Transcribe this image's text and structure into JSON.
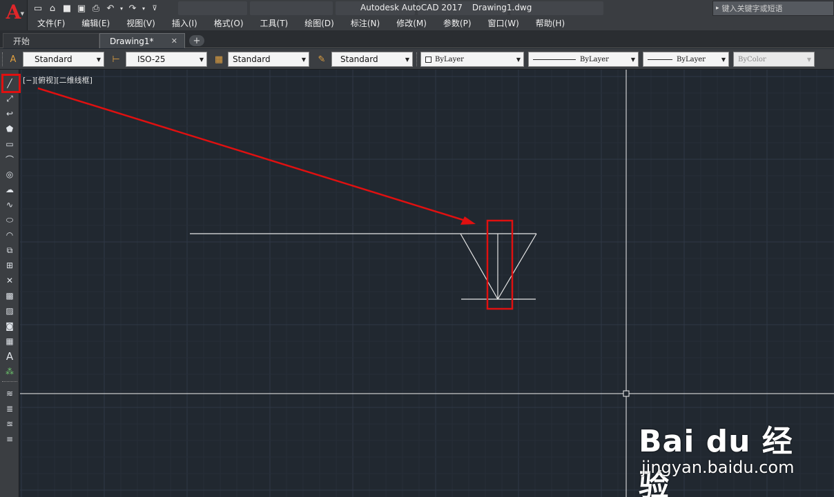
{
  "app": {
    "title": "Autodesk AutoCAD 2017",
    "document": "Drawing1.dwg",
    "logo_letter": "A",
    "accent": "#e0262a"
  },
  "search": {
    "placeholder": "键入关键字或短语"
  },
  "menu": {
    "items": [
      "文件(F)",
      "编辑(E)",
      "视图(V)",
      "插入(I)",
      "格式(O)",
      "工具(T)",
      "绘图(D)",
      "标注(N)",
      "修改(M)",
      "参数(P)",
      "窗口(W)",
      "帮助(H)"
    ]
  },
  "tabs": {
    "start": "开始",
    "drawing": "Drawing1*",
    "close": "✕",
    "add": "+"
  },
  "styles": {
    "text_style": "Standard",
    "dim_style": "ISO-25",
    "table_style": "Standard",
    "mleader_style": "Standard",
    "color": "ByLayer",
    "linetype": "ByLayer",
    "lineweight": "ByLayer",
    "plotstyle": "ByColor"
  },
  "viewport": {
    "label": "[−][俯视][二维线框]"
  },
  "draw_tools": [
    "line-icon",
    "construction-line-icon",
    "polyline-icon",
    "polygon-icon",
    "rectangle-icon",
    "arc-icon",
    "circle-icon",
    "revision-cloud-icon",
    "spline-icon",
    "ellipse-icon",
    "ellipse-arc-icon",
    "insert-block-icon",
    "make-block-icon",
    "point-icon",
    "hatch-icon",
    "gradient-icon",
    "region-icon",
    "table-icon",
    "multiline-text-icon",
    "add-selected-icon",
    "layer-properties-icon",
    "layer-state-icon",
    "layer-previous-icon",
    "layer-isolate-icon"
  ],
  "annotation_color": "#e01010",
  "watermark": {
    "logo": "Bai du 经验",
    "url": "jingyan.baidu.com"
  }
}
